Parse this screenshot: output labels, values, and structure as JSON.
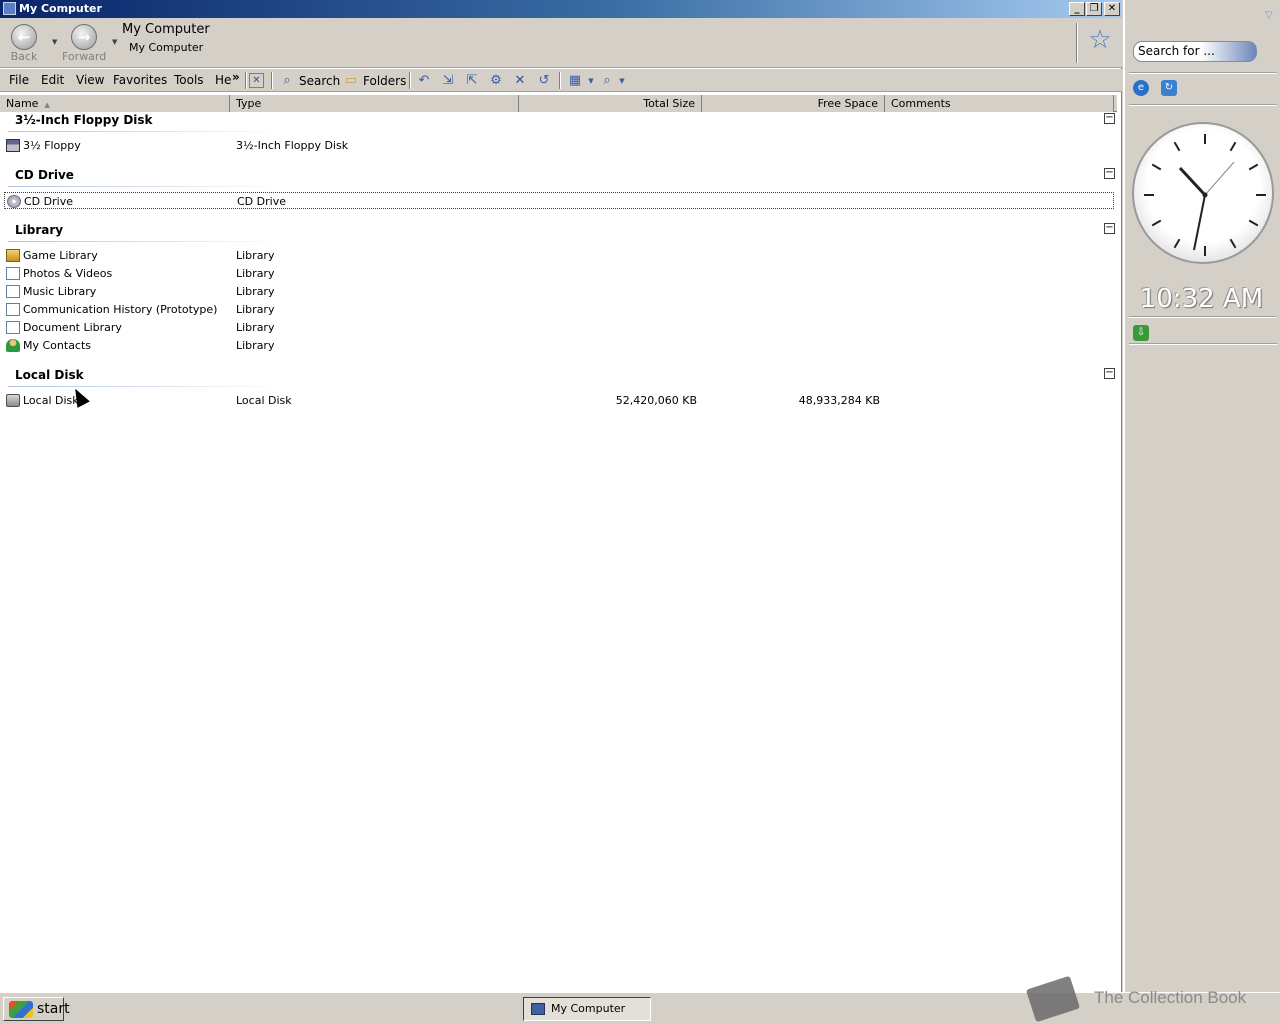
{
  "window": {
    "title": "My Computer",
    "caption_buttons": {
      "minimize": "_",
      "restore": "❐",
      "close": "✕"
    }
  },
  "navbar": {
    "back_label": "Back",
    "forward_label": "Forward",
    "address_title": "My Computer",
    "address_sub": "My Computer"
  },
  "menu": {
    "file": "File",
    "edit": "Edit",
    "view": "View",
    "favorites": "Favorites",
    "tools": "Tools",
    "help": "He",
    "overflow": "»"
  },
  "toolbar": {
    "search_label": "Search",
    "folders_label": "Folders"
  },
  "columns": {
    "name": "Name",
    "type": "Type",
    "total_size": "Total Size",
    "free_space": "Free Space",
    "comments": "Comments"
  },
  "groups": [
    {
      "title": "3½-Inch Floppy Disk",
      "items": [
        {
          "name": "3½ Floppy",
          "type": "3½-Inch Floppy Disk",
          "total": "",
          "free": "",
          "icon": "floppy-icon"
        }
      ]
    },
    {
      "title": "CD Drive",
      "items": [
        {
          "name": "CD Drive",
          "type": "CD Drive",
          "total": "",
          "free": "",
          "icon": "cd-drive-icon"
        }
      ]
    },
    {
      "title": "Library",
      "items": [
        {
          "name": "Game Library",
          "type": "Library",
          "total": "",
          "free": "",
          "icon": "game-library-icon"
        },
        {
          "name": "Photos & Videos",
          "type": "Library",
          "total": "",
          "free": "",
          "icon": "library-icon"
        },
        {
          "name": "Music Library",
          "type": "Library",
          "total": "",
          "free": "",
          "icon": "library-icon"
        },
        {
          "name": "Communication History (Prototype)",
          "type": "Library",
          "total": "",
          "free": "",
          "icon": "library-icon"
        },
        {
          "name": "Document Library",
          "type": "Library",
          "total": "",
          "free": "",
          "icon": "library-icon"
        },
        {
          "name": "My Contacts",
          "type": "Library",
          "total": "",
          "free": "",
          "icon": "contacts-icon"
        }
      ]
    },
    {
      "title": "Local Disk",
      "items": [
        {
          "name": "Local Disk",
          "type": "Local Disk",
          "total": "52,420,060 KB",
          "free": "48,933,284 KB",
          "icon": "hard-disk-icon"
        }
      ]
    }
  ],
  "sidebar": {
    "search_placeholder": "Search for ...",
    "time": "10:32 AM"
  },
  "taskbar": {
    "start_label": "start",
    "task_label": "My Computer"
  },
  "watermark": {
    "text": "The Collection Book"
  }
}
